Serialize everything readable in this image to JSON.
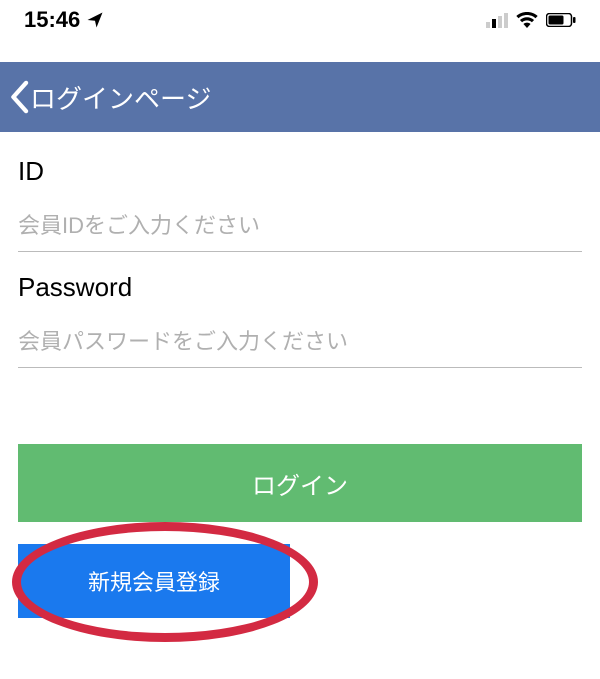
{
  "status_bar": {
    "time": "15:46",
    "location_icon": "➤"
  },
  "nav": {
    "title": "ログインページ"
  },
  "form": {
    "id_label": "ID",
    "id_placeholder": "会員IDをご入力ください",
    "password_label": "Password",
    "password_placeholder": "会員パスワードをご入力ください"
  },
  "buttons": {
    "login": "ログイン",
    "register": "新規会員登録"
  },
  "colors": {
    "nav_bg": "#5873a8",
    "login_btn": "#61bb71",
    "register_btn": "#1a79ee",
    "annotation": "#d32a42"
  }
}
